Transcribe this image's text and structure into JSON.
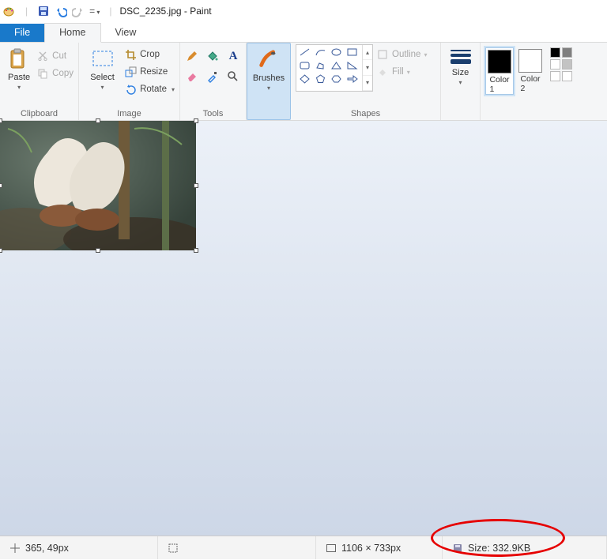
{
  "window": {
    "title": "DSC_2235.jpg - Paint"
  },
  "tabs": {
    "file": "File",
    "home": "Home",
    "view": "View"
  },
  "ribbon": {
    "clipboard": {
      "label": "Clipboard",
      "paste": "Paste",
      "cut": "Cut",
      "copy": "Copy"
    },
    "image": {
      "label": "Image",
      "select": "Select",
      "crop": "Crop",
      "resize": "Resize",
      "rotate": "Rotate"
    },
    "tools": {
      "label": "Tools"
    },
    "brushes": {
      "label": "Brushes"
    },
    "shapes": {
      "label": "Shapes",
      "outline": "Outline",
      "fill": "Fill"
    },
    "size": {
      "label": "Size"
    },
    "colors": {
      "c1": "Color\n1",
      "c2": "Color\n2",
      "c1_hex": "#000000",
      "c2_hex": "#ffffff",
      "row1": [
        "#000000",
        "#7f7f7f"
      ],
      "row2": [
        "#ffffff",
        "#c3c3c3"
      ],
      "row3": [
        "#ffffff",
        "#ffffff"
      ]
    }
  },
  "status": {
    "pos": "365, 49px",
    "sel": "",
    "dim": "1106 × 733px",
    "size": "Size: 332.9KB"
  }
}
